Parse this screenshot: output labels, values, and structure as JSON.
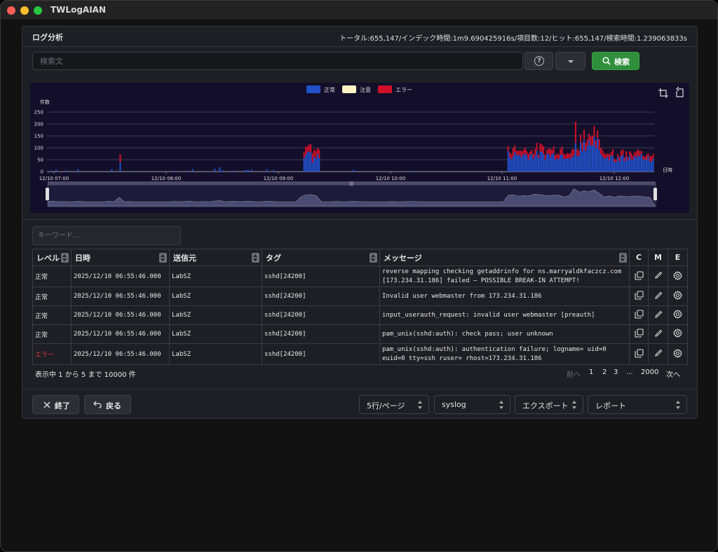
{
  "app": {
    "title": "TWLogAIAN"
  },
  "header": {
    "title": "ログ分析",
    "stats": "トータル:655,147/インデック時間:1m9.690425916s/項目数:12/ヒット:655,147/検索時間:1.239063833s"
  },
  "search": {
    "placeholder": "検索文",
    "value": "",
    "help_icon": "help-circle-icon",
    "button_label": "検索"
  },
  "chart_data": {
    "type": "bar",
    "stacked": true,
    "ylabel": "件数",
    "xlabel": "日時",
    "ylim": [
      0,
      250
    ],
    "yticks": [
      "250",
      "200",
      "150",
      "100",
      "50",
      "0"
    ],
    "xticks": [
      "12/10 07:00",
      "12/10 08:00",
      "12/10 09:00",
      "12/10 10:00",
      "12/10 11:00",
      "12/10 12:00"
    ],
    "legend_position": "top-center",
    "series": [
      {
        "name": "正常",
        "color": "#2250c9"
      },
      {
        "name": "注意",
        "color": "#fff3c4"
      },
      {
        "name": "エラー",
        "color": "#d0102b"
      }
    ],
    "x_values": [
      "12/10 07:00",
      "12/10 08:00",
      "12/10 09:00",
      "12/10 10:00",
      "12/10 11:00",
      "12/10 12:00"
    ],
    "bin_count": 360,
    "normal_values_per_bin": [
      [
        9,
        10,
        55,
        0,
        0,
        0,
        18,
        0,
        0,
        0,
        0,
        0
      ],
      [
        0,
        0,
        0,
        0,
        0,
        0,
        0,
        0,
        0,
        10,
        0,
        0
      ],
      [
        0,
        0,
        0,
        0,
        0,
        60,
        85,
        70,
        0,
        0,
        0,
        0
      ]
    ],
    "error_values": {
      "peak_max": 210,
      "morning_peak": 75,
      "mid_peak": 115
    },
    "toolbox_icons": [
      "zoom-select-icon",
      "zoom-reset-icon"
    ]
  },
  "keyword": {
    "placeholder": "キーワード..."
  },
  "table": {
    "columns": [
      "レベル",
      "日時",
      "送信元",
      "タグ",
      "メッセージ",
      "C",
      "M",
      "E"
    ],
    "rows": [
      {
        "level": "正常",
        "level_type": "normal",
        "time": "2025/12/10 06:55:46.000",
        "source": "LabSZ",
        "tag": "sshd[24200]",
        "message": "reverse mapping checking getaddrinfo for ns.marryaldkfaczcz.com [173.234.31.186] failed – POSSIBLE BREAK-IN ATTEMPT!"
      },
      {
        "level": "正常",
        "level_type": "normal",
        "time": "2025/12/10 06:55:46.000",
        "source": "LabSZ",
        "tag": "sshd[24200]",
        "message": "Invalid user webmaster from 173.234.31.186"
      },
      {
        "level": "正常",
        "level_type": "normal",
        "time": "2025/12/10 06:55:46.000",
        "source": "LabSZ",
        "tag": "sshd[24200]",
        "message": "input_userauth_request: invalid user webmaster [preauth]"
      },
      {
        "level": "正常",
        "level_type": "normal",
        "time": "2025/12/10 06:55:46.000",
        "source": "LabSZ",
        "tag": "sshd[24200]",
        "message": "pam_unix(sshd:auth): check pass; user unknown"
      },
      {
        "level": "エラー",
        "level_type": "error",
        "time": "2025/12/10 06:55:46.000",
        "source": "LabSZ",
        "tag": "sshd[24200]",
        "message": "pam_unix(sshd:auth): authentication failure; logname= uid=0 euid=0 tty=ssh ruser= rhost=173.234.31.186"
      }
    ],
    "row_icons": [
      "copy-icon",
      "pencil-icon",
      "gear-icon"
    ]
  },
  "footer_info": "表示中 1 から 5 まで 10000 件",
  "pagination": {
    "prev": "前へ",
    "pages": [
      "1",
      "2",
      "3",
      "...",
      "2000"
    ],
    "next": "次へ"
  },
  "buttons": {
    "end": "終了",
    "back": "戻る"
  },
  "selects": {
    "page_size": "5行/ページ",
    "log_type": "syslog",
    "export": "エクスポート",
    "report": "レポート"
  }
}
